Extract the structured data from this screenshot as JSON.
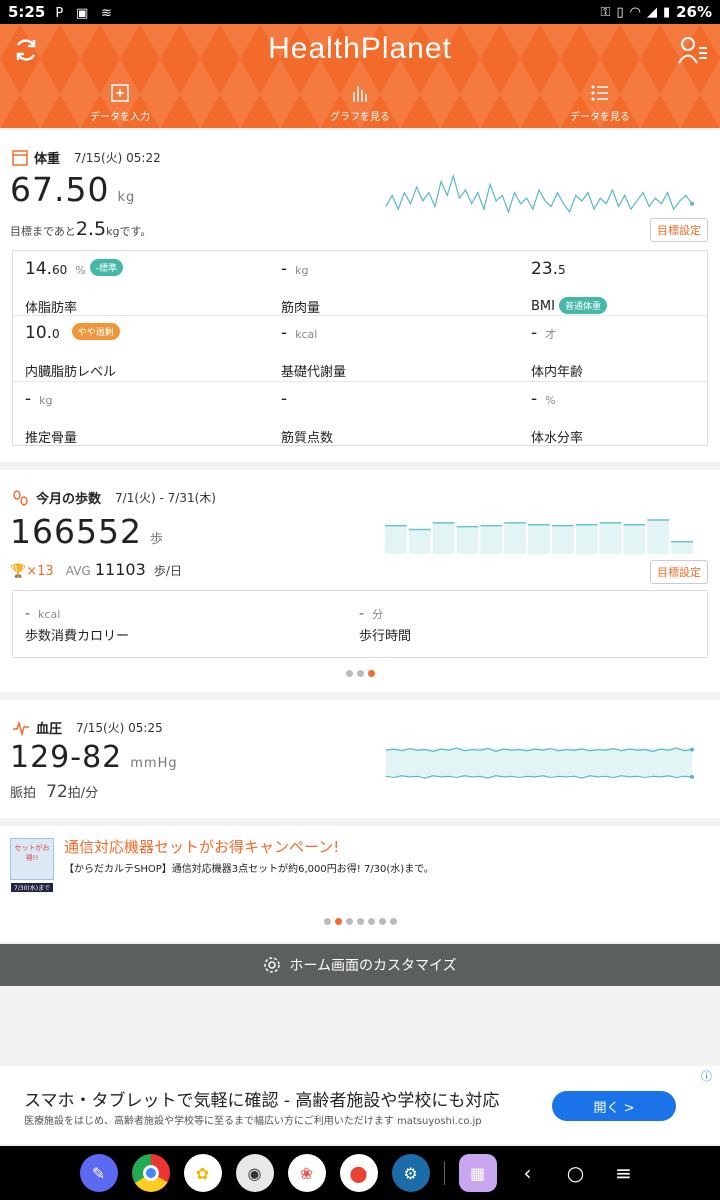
{
  "status_bar": {
    "time": "5:25",
    "battery": "26%"
  },
  "header": {
    "logo": "HealthPlanet",
    "nav": [
      {
        "label": "データを入力",
        "icon": "plus-square-icon"
      },
      {
        "label": "グラフを見る",
        "icon": "bar-graph-icon"
      },
      {
        "label": "データを見る",
        "icon": "list-icon"
      }
    ]
  },
  "weight": {
    "title": "体重",
    "date": "7/15(火) 05:22",
    "value": "67.50",
    "unit": "kg",
    "goal_prefix": "目標まであと",
    "goal_value": "2.5",
    "goal_unit": "kg",
    "goal_suffix": "です。",
    "goal_button": "目標設定",
    "metrics": [
      {
        "value": "14.",
        "value_small": "60",
        "unit": "%",
        "label": "体脂肪率",
        "badge": "-標準",
        "badge_color": "#45b8a8"
      },
      {
        "value": "-",
        "value_small": "",
        "unit": "kg",
        "label": "筋肉量",
        "badge": "",
        "badge_color": ""
      },
      {
        "value": "23.",
        "value_small": "5",
        "unit": "",
        "label": "BMI",
        "badge": "普通体重",
        "badge_color": "#45b8a8"
      },
      {
        "value": "10.",
        "value_small": "0",
        "unit": "",
        "label": "内臓脂肪レベル",
        "badge": "やや過剰",
        "badge_color": "#f0963a"
      },
      {
        "value": "-",
        "value_small": "",
        "unit": "kcal",
        "label": "基礎代謝量",
        "badge": "",
        "badge_color": ""
      },
      {
        "value": "-",
        "value_small": "",
        "unit": "才",
        "label": "体内年齢",
        "badge": "",
        "badge_color": ""
      },
      {
        "value": "-",
        "value_small": "",
        "unit": "kg",
        "label": "推定骨量",
        "badge": "",
        "badge_color": ""
      },
      {
        "value": "-",
        "value_small": "",
        "unit": "",
        "label": "筋質点数",
        "badge": "",
        "badge_color": ""
      },
      {
        "value": "-",
        "value_small": "",
        "unit": "%",
        "label": "体水分率",
        "badge": "",
        "badge_color": ""
      }
    ]
  },
  "steps": {
    "title": "今月の歩数",
    "date": "7/1(火) - 7/31(木)",
    "value": "166552",
    "unit": "歩",
    "trophy_count": "×13",
    "avg_label": "AVG",
    "avg_value": "11103",
    "avg_unit": "歩/日",
    "goal_button": "目標設定",
    "stats": [
      {
        "value": "-",
        "unit": "kcal",
        "label": "歩数消費カロリー"
      },
      {
        "value": "-",
        "unit": "分",
        "label": "歩行時間"
      }
    ]
  },
  "bp": {
    "title": "血圧",
    "date": "7/15(火) 05:25",
    "value": "129-82",
    "unit": "mmHg",
    "pulse_label": "脈拍",
    "pulse_value": "72",
    "pulse_unit": "拍/分"
  },
  "promo": {
    "title": "通信対応機器セットがお得キャンペーン!",
    "text": "【からだカルテSHOP】通信対応機器3点セットが約6,000円お得! 7/30(水)まで。",
    "image_text": "セットがお得!!",
    "image_date": "7/30(水)まで"
  },
  "customize_label": "ホーム画面のカスタマイズ",
  "ad": {
    "headline": "スマホ・タブレットで気軽に確認 - 高齢者施設や学校にも対応",
    "description": "医療施設をはじめ、高齢者施設や学校等に至るまで幅広い方にご利用いただけます matsuyoshi.co.jp",
    "button": "開く >"
  },
  "colors": {
    "accent": "#f36b2a",
    "teal": "#45b8a8",
    "orange_badge": "#f0963a"
  },
  "chart_data": [
    {
      "type": "line",
      "series": [
        {
          "values": [
            67.4,
            67.8,
            67.3,
            67.9,
            67.5,
            68.1,
            67.6,
            67.9,
            67.4,
            68.3,
            67.8,
            68.5,
            67.7,
            68.0,
            67.5,
            67.9,
            67.3,
            68.2,
            67.6,
            67.8,
            67.2,
            67.9,
            67.5,
            67.7,
            67.3,
            68.0,
            67.6,
            67.4,
            67.9,
            67.5,
            67.2,
            67.8,
            67.6,
            67.9,
            67.3,
            67.7,
            67.5,
            68.0,
            67.4,
            67.8,
            67.3,
            67.6,
            67.9,
            67.4,
            67.7,
            67.5,
            67.9,
            67.3,
            67.6,
            67.8,
            67.5
          ]
        }
      ]
    },
    {
      "type": "bar",
      "values": [
        6,
        5.2,
        6.6,
        5.8,
        6.0,
        6.6,
        6.2,
        6.0,
        6.2,
        6.6,
        6.2,
        7.2,
        2.6
      ]
    },
    {
      "type": "line",
      "series": [
        {
          "values": [
            129,
            131,
            128,
            132,
            129,
            130,
            127,
            131,
            129,
            133,
            128,
            130,
            129,
            132,
            127,
            131,
            129,
            130,
            128,
            131,
            129,
            132,
            128,
            130,
            129,
            131,
            128,
            130,
            129,
            132,
            128,
            131,
            129,
            130,
            127,
            131,
            129,
            133,
            128,
            130
          ]
        },
        {
          "values": [
            82,
            80,
            83,
            81,
            82,
            79,
            83,
            81,
            82,
            80,
            83,
            81,
            82,
            79,
            83,
            81,
            82,
            80,
            82,
            81,
            83,
            80,
            82,
            81,
            82,
            79,
            83,
            81,
            82,
            80,
            83,
            81,
            82,
            80,
            82,
            81,
            83,
            80,
            82,
            81
          ]
        }
      ]
    }
  ]
}
